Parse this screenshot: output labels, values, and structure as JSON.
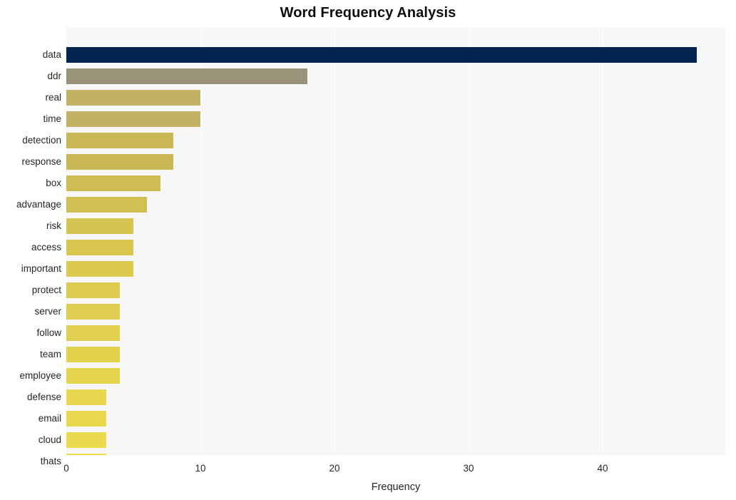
{
  "chart_data": {
    "type": "bar",
    "orientation": "horizontal",
    "title": "Word Frequency Analysis",
    "xlabel": "Frequency",
    "ylabel": "",
    "categories": [
      "data",
      "ddr",
      "real",
      "time",
      "detection",
      "response",
      "box",
      "advantage",
      "risk",
      "access",
      "important",
      "protect",
      "server",
      "follow",
      "team",
      "employee",
      "defense",
      "email",
      "cloud",
      "thats"
    ],
    "values": [
      47,
      18,
      10,
      10,
      8,
      8,
      7,
      6,
      5,
      5,
      5,
      4,
      4,
      4,
      4,
      4,
      3,
      3,
      3,
      3
    ],
    "bar_colors": [
      "#04254f",
      "#999479",
      "#c4b264",
      "#c4b264",
      "#cbb855",
      "#cbb855",
      "#cfbc52",
      "#d2bf51",
      "#d6c450",
      "#d8c650",
      "#dac84f",
      "#dccb4f",
      "#dfcd4f",
      "#e1d04e",
      "#e3d24e",
      "#e5d44e",
      "#e8d74e",
      "#ead94e",
      "#ecda4e",
      "#efdb4e"
    ],
    "xlim": [
      0,
      49
    ],
    "ylim_categories_order": "descending-by-value",
    "xticks": [
      0,
      10,
      20,
      30,
      40
    ],
    "xtick_labels": [
      "0",
      "10",
      "20",
      "30",
      "40"
    ],
    "grid": {
      "vertical": true,
      "horizontal": false,
      "color": "#ffffff"
    },
    "legend": null,
    "plot_background": "#f7f7f7",
    "figure_background": "#ffffff"
  }
}
